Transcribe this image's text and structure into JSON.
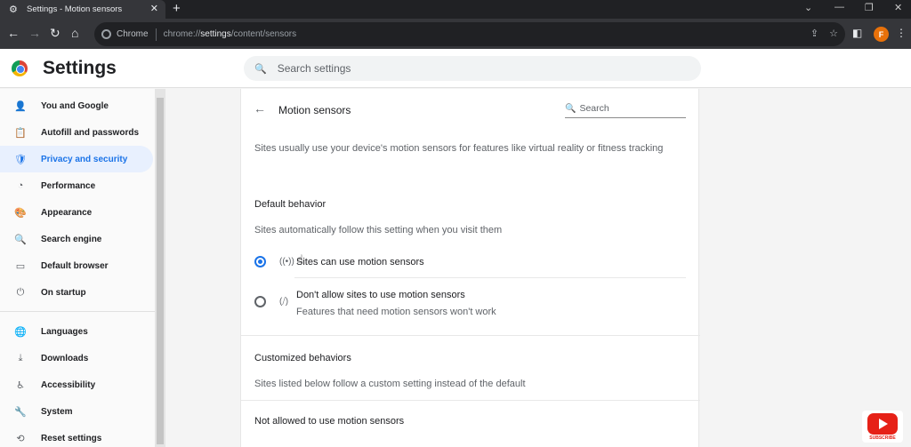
{
  "browser": {
    "tab_title": "Settings - Motion sensors",
    "tab_close": "✕",
    "new_tab": "+",
    "site_name": "Chrome",
    "url_prefix": "chrome://",
    "url_host": "settings",
    "url_path": "/content/sensors",
    "profile_initial": "F"
  },
  "header": {
    "title": "Settings",
    "search_placeholder": "Search settings"
  },
  "sidebar": {
    "items": [
      {
        "label": "You and Google",
        "icon": "person-icon",
        "glyph": "👤"
      },
      {
        "label": "Autofill and passwords",
        "icon": "clipboard-icon",
        "glyph": "📋"
      },
      {
        "label": "Privacy and security",
        "icon": "shield-icon",
        "glyph": "🛡"
      },
      {
        "label": "Performance",
        "icon": "speedometer-icon",
        "glyph": "◔"
      },
      {
        "label": "Appearance",
        "icon": "palette-icon",
        "glyph": "🎨"
      },
      {
        "label": "Search engine",
        "icon": "search-icon",
        "glyph": "🔍"
      },
      {
        "label": "Default browser",
        "icon": "browser-icon",
        "glyph": "▭"
      },
      {
        "label": "On startup",
        "icon": "power-icon",
        "glyph": "⏻"
      },
      {
        "label": "Languages",
        "icon": "globe-icon",
        "glyph": "🌐"
      },
      {
        "label": "Downloads",
        "icon": "download-icon",
        "glyph": "⤓"
      },
      {
        "label": "Accessibility",
        "icon": "accessibility-icon",
        "glyph": "♿"
      },
      {
        "label": "System",
        "icon": "wrench-icon",
        "glyph": "🔧"
      },
      {
        "label": "Reset settings",
        "icon": "reset-icon",
        "glyph": "⟲"
      }
    ],
    "active_index": 2
  },
  "panel": {
    "title": "Motion sensors",
    "search_placeholder": "Search",
    "description": "Sites usually use your device's motion sensors for features like virtual reality or fitness tracking",
    "default_heading": "Default behavior",
    "default_sub": "Sites automatically follow this setting when you visit them",
    "options": [
      {
        "label": "Sites can use motion sensors",
        "sub": "",
        "checked": true,
        "icon": "sensors-icon"
      },
      {
        "label": "Don't allow sites to use motion sensors",
        "sub": "Features that need motion sensors won't work",
        "checked": false,
        "icon": "sensors-off-icon"
      }
    ],
    "custom_heading": "Customized behaviors",
    "custom_sub": "Sites listed below follow a custom setting instead of the default",
    "not_allowed_heading": "Not allowed to use motion sensors"
  },
  "overlay": {
    "subscribe_text": "SUBSCRIBE"
  },
  "colors": {
    "accent": "#1a73e8",
    "active_bg": "#e8f0fe",
    "toolbar": "#35363a",
    "tabstrip": "#202124"
  }
}
